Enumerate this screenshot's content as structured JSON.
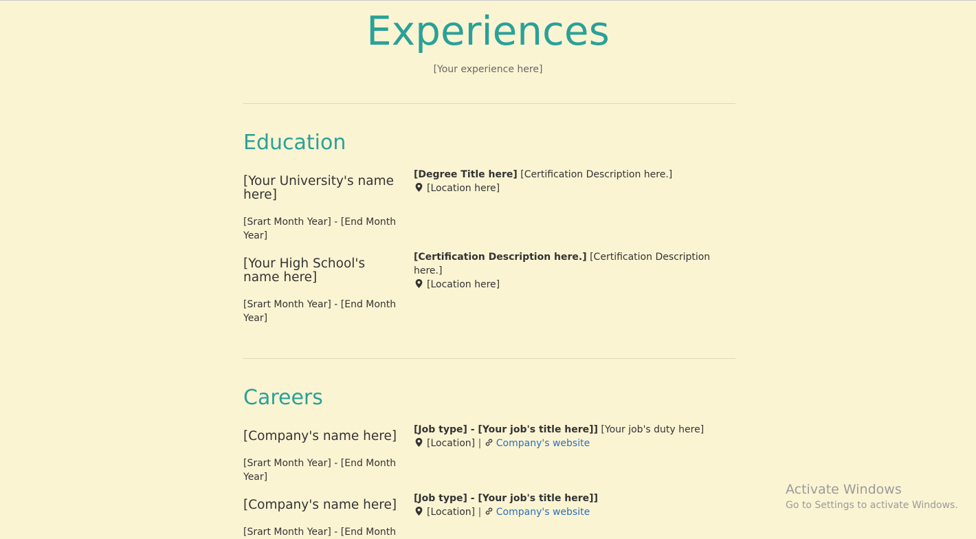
{
  "header": {
    "title": "Experiences",
    "subtitle": "[Your experience here]"
  },
  "education": {
    "title": "Education",
    "entries": [
      {
        "name": "[Your University's name here]",
        "dates": "[Srart Month Year] - [End Month Year]",
        "degree": "[Degree Title here]",
        "description": "[Certification Description here.]",
        "location": "[Location here]"
      },
      {
        "name": "[Your High School's name here]",
        "dates": "[Srart Month Year] - [End Month Year]",
        "degree": "[Certification Description here.]",
        "description": "[Certification Description here.]",
        "location": "[Location here]"
      }
    ]
  },
  "careers": {
    "title": "Careers",
    "entries": [
      {
        "name": "[Company's name here]",
        "dates": "[Srart Month Year] - [End Month Year]",
        "job": "[Job type] - [Your job's title here]]",
        "duty": "[Your job's duty here]",
        "location": "[Location]",
        "separator": "|",
        "website": "Company's website"
      },
      {
        "name": "[Company's name here]",
        "dates": "[Srart Month Year] - [End Month",
        "job": "[Job type] - [Your job's title here]]",
        "duty": "",
        "location": "[Location]",
        "separator": "|",
        "website": "Company's website"
      }
    ]
  },
  "watermark": {
    "title": "Activate Windows",
    "subtitle": "Go to Settings to activate Windows."
  },
  "colors": {
    "background": "#fbf4d3",
    "accent": "#2aa198",
    "link": "#2a6fba"
  }
}
